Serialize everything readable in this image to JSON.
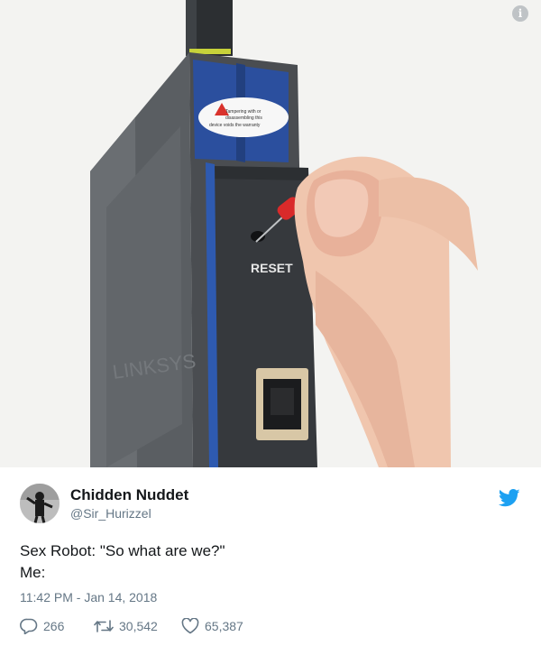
{
  "photo": {
    "label_text": "RESET",
    "warning_text": [
      "Tampering with or",
      "disassembling this",
      "device voids the warranty"
    ],
    "brand_text": "LINKSYS"
  },
  "tweet": {
    "display_name": "Chidden Nuddet",
    "handle": "@Sir_Hurizzel",
    "text_lines": [
      "Sex Robot: \"So what are we?\"",
      "Me:"
    ],
    "timestamp": "11:42 PM - Jan 14, 2018",
    "actions": {
      "replies": "266",
      "retweets": "30,542",
      "likes": "65,387"
    }
  },
  "colors": {
    "twitter_blue": "#1da1f2",
    "secondary_text": "#657786",
    "primary_text": "#14171a"
  },
  "icons": [
    "info-icon",
    "twitter-bird-icon",
    "reply-icon",
    "retweet-icon",
    "heart-icon"
  ]
}
